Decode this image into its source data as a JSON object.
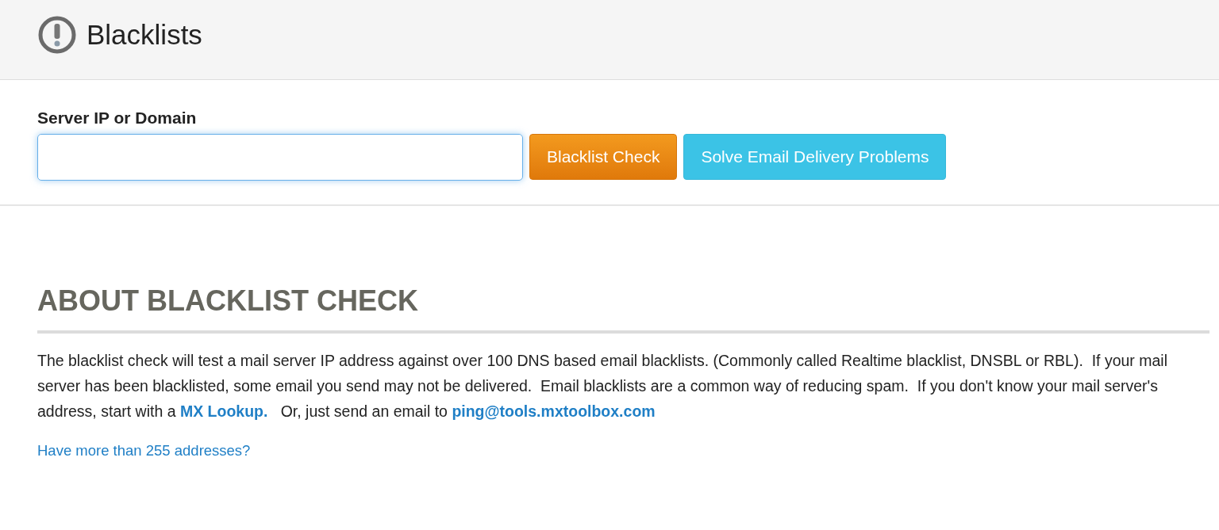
{
  "header": {
    "title": "Blacklists"
  },
  "lookup_form": {
    "label": "Server IP or Domain",
    "input": {
      "focused": true
    },
    "buttons": [
      {
        "label": "Blacklist Check",
        "kind": "primary"
      },
      {
        "label": "Solve Email Delivery Problems",
        "kind": "info"
      }
    ]
  },
  "about": {
    "heading": "ABOUT BLACKLIST CHECK",
    "paragraph": {
      "text_before": "The blacklist check will test a mail server IP address against over 100 DNS based email blacklists. (Commonly called Realtime blacklist, DNSBL or RBL).  If your mail server has been blacklisted, some email you send may not be delivered.  Email blacklists are a common way of reducing spam.  If you don't know your mail server's address, start with a ",
      "lookup_link": "MX Lookup.",
      "text_middle": "   Or, just send an email to ",
      "email_link": "ping@tools.mxtoolbox.com"
    },
    "more_link": "Have more than 255 addresses?"
  }
}
